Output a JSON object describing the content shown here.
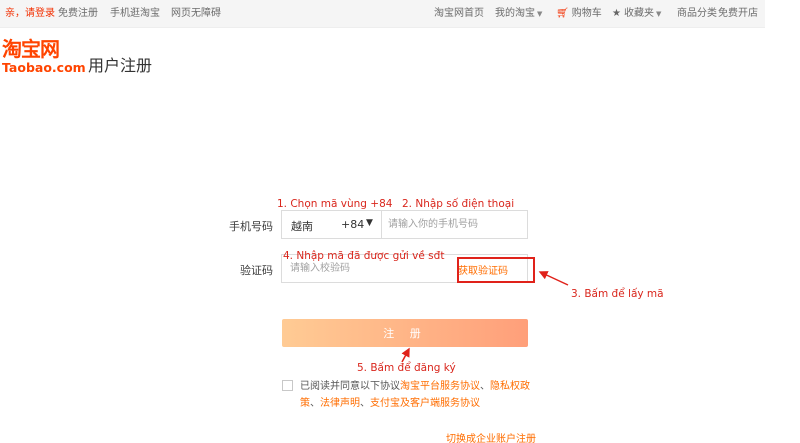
{
  "topbar": {
    "greeting": "亲，请登录",
    "free_register": "免费注册",
    "mobile_taobao": "手机逛淘宝",
    "accessibility": "网页无障碍",
    "home": "淘宝网首页",
    "my_taobao": "我的淘宝",
    "cart": "购物车",
    "favorites": "收藏夹",
    "categories": "商品分类",
    "open_store": "免费开店"
  },
  "logo": {
    "cn": "淘宝网",
    "en": "Taobao.com"
  },
  "page": {
    "title": "用户注册"
  },
  "form": {
    "phone_label": "手机号码",
    "region_country": "越南",
    "region_code": "+84",
    "phone_placeholder": "请输入你的手机号码",
    "code_label": "验证码",
    "code_placeholder": "请输入校验码",
    "get_code_label": "获取验证码",
    "submit_label": "注 册",
    "agree_prefix": "已阅读并同意以下协议",
    "agree_link1": "淘宝平台服务协议",
    "agree_sep1": "、",
    "agree_link2": "隐私权政策",
    "agree_sep2": "、",
    "agree_link3": "法律声明",
    "agree_sep3": "、",
    "agree_link4": "支付宝及客户端服务协议",
    "switch_link": "切换成企业账户注册"
  },
  "annotations": {
    "step1": "1. Chọn mã vùng +84",
    "step2": "2. Nhập số điện thoại",
    "step3": "3. Bấm để lấy mã",
    "step4": "4. Nhập mã đã được gửi về sđt",
    "step5": "5. Bấm để đăng ký"
  },
  "colors": {
    "brand": "#ff4400",
    "link": "#ff6d00",
    "annotation": "#d9261c",
    "button_from": "#ffcb94",
    "button_to": "#ff9f7a"
  },
  "icons": [
    "cart-icon",
    "star-icon",
    "chevron-down-icon"
  ]
}
